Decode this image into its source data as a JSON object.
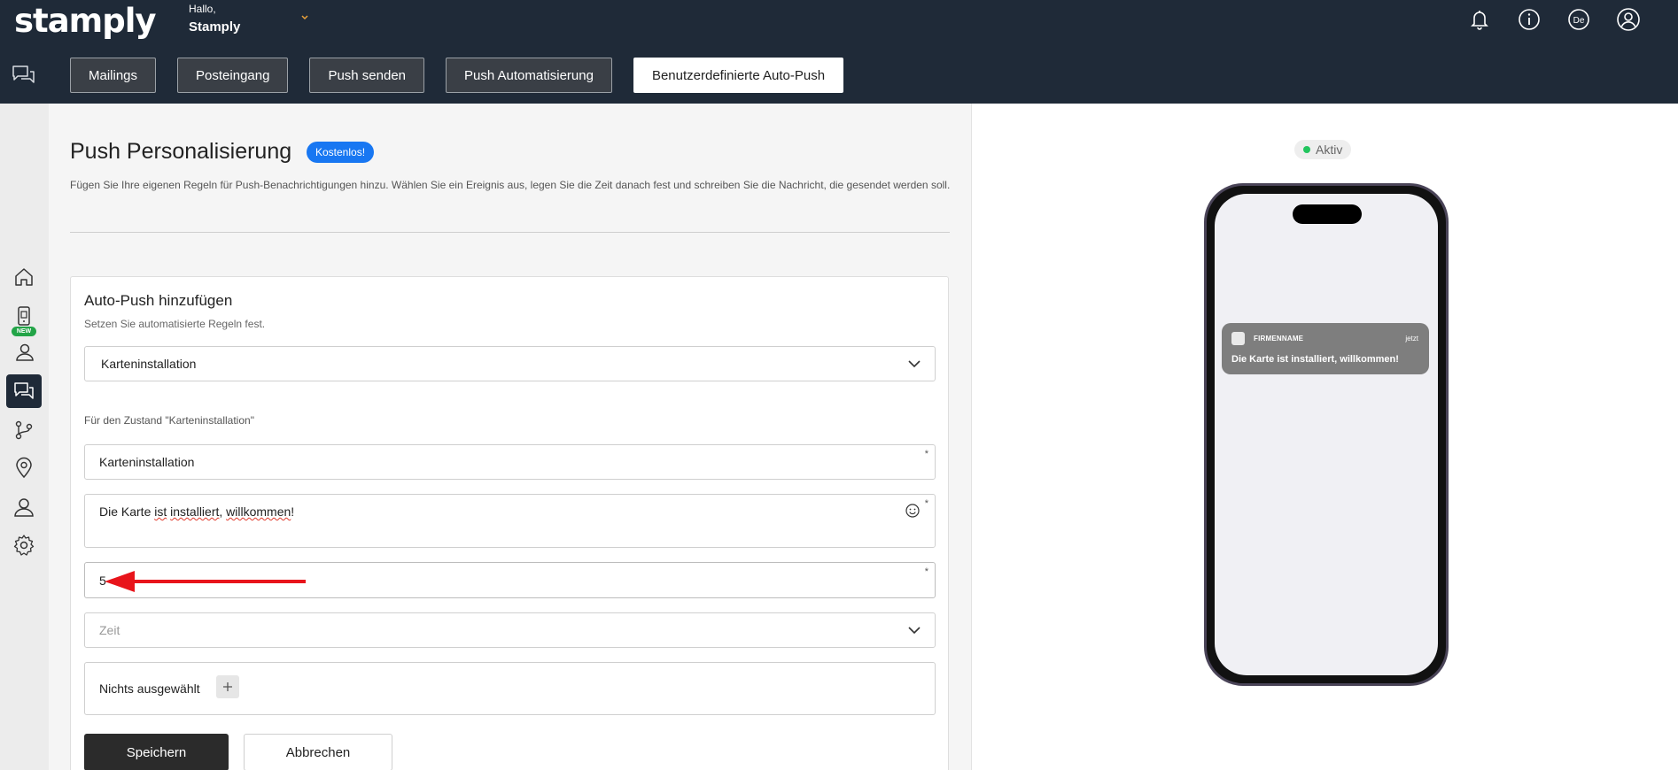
{
  "header": {
    "logo_text": "stamply",
    "greeting": "Hallo,",
    "user_name": "Stamply",
    "language_badge": "De",
    "icons": [
      "bell-icon",
      "info-icon",
      "language-icon",
      "account-icon"
    ]
  },
  "tabs": [
    {
      "label": "Mailings"
    },
    {
      "label": "Posteingang"
    },
    {
      "label": "Push senden"
    },
    {
      "label": "Push Automatisierung"
    },
    {
      "label": "Benutzerdefinierte Auto-Push",
      "active": true
    }
  ],
  "sidebar": {
    "items": [
      "home-icon",
      "mobile-card-icon",
      "customers-icon",
      "chat-icon",
      "flow-icon",
      "location-icon",
      "user-icon",
      "settings-icon"
    ],
    "new_badge": "NEW",
    "active_item": "chat-icon"
  },
  "page": {
    "title": "Push Personalisierung",
    "badge": "Kostenlos!",
    "description": "Fügen Sie Ihre eigenen Regeln für Push-Benachrichtigungen hinzu. Wählen Sie ein Ereignis aus, legen Sie die Zeit danach fest und schreiben Sie die Nachricht, die gesendet werden soll."
  },
  "form": {
    "title": "Auto-Push hinzufügen",
    "subtitle": "Setzen Sie automatisierte Regeln fest.",
    "event_select": "Karteninstallation",
    "condition_label": "Für den Zustand \"Karteninstallation\"",
    "name_value": "Karteninstallation",
    "message_words": [
      "Die Karte",
      "ist",
      "installiert",
      ",",
      "willkommen",
      "!"
    ],
    "delay_value": "5",
    "time_placeholder": "Zeit",
    "segment_label": "Nichts ausgewählt",
    "required_mark": "*",
    "save_label": "Speichern",
    "cancel_label": "Abbrechen"
  },
  "preview": {
    "status": "Aktiv",
    "status_color": "#22c55e",
    "notification": {
      "app_name": "FIRMENNAME",
      "time": "jetzt",
      "message": "Die Karte ist installiert, willkommen!"
    }
  },
  "colors": {
    "topbar": "#1f2a38",
    "badge_blue": "#1877f2",
    "annotation_arrow": "#e8141b"
  }
}
